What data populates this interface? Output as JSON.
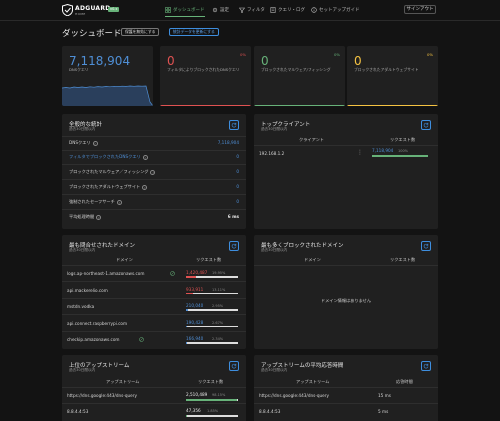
{
  "header": {
    "logo_text": "ADGUARD",
    "logo_sub": "HOME",
    "badge": "v0.x",
    "nav": [
      {
        "label": "ダッシュボード",
        "icon": "dashboard-icon",
        "active": true
      },
      {
        "label": "設定",
        "icon": "gear-icon",
        "active": false
      },
      {
        "label": "フィルタ",
        "icon": "filter-icon",
        "active": false
      },
      {
        "label": "クエリ・ログ",
        "icon": "log-icon",
        "active": false
      },
      {
        "label": "セットアップガイド",
        "icon": "guide-icon",
        "active": false
      }
    ],
    "signout_label": "サインアウト"
  },
  "title_row": {
    "title": "ダッシュボード",
    "protection_button": "保護を無効にする",
    "refresh_button": "統計データを更新にする"
  },
  "stats": [
    {
      "value": "7,118,904",
      "label": "DNSクエリ",
      "pct": "",
      "color": "#4f8fd6"
    },
    {
      "value": "0",
      "label": "フィルタによりブロックされたDNSクエリ",
      "pct": "0%",
      "color": "#e05252"
    },
    {
      "value": "0",
      "label": "ブロックされたマルウェア/フィッシング",
      "pct": "0%",
      "color": "#67b279"
    },
    {
      "value": "0",
      "label": "ブロックされたアダルトウェブサイト",
      "pct": "0%",
      "color": "#f5c342"
    }
  ],
  "general_stats": {
    "title": "全般的な統計",
    "subtitle": "過去30日間以内",
    "rows": [
      {
        "label": "DNSクエリ",
        "value": "7,118,904",
        "label_blue": false
      },
      {
        "label": "フィルタでブロックされたDNSクエリ",
        "value": "0",
        "label_blue": true
      },
      {
        "label": "ブロックされたマルウェア／フィッシング",
        "value": "0",
        "label_blue": false
      },
      {
        "label": "ブロックされたアダルトウェブサイト",
        "value": "0",
        "label_blue": false
      },
      {
        "label": "強制されたセーフサーチ",
        "value": "0",
        "label_blue": false
      },
      {
        "label": "平均処理時間",
        "value": "6 ms",
        "label_blue": false
      }
    ]
  },
  "top_clients": {
    "title": "トップクライアント",
    "subtitle": "過去30日間以内",
    "col_client": "クライアント",
    "col_requests": "リクエスト数",
    "rows": [
      {
        "client": "192.168.1.2",
        "count": "7,118,904",
        "pct": "100%",
        "fraction": 1.0
      }
    ]
  },
  "top_domains": {
    "title": "最も問合せされたドメイン",
    "subtitle": "過去30日間以内",
    "col_domain": "ドメイン",
    "col_requests": "リクエスト数",
    "rows": [
      {
        "domain": "logs.ap-northeast-1.amazonaws.com",
        "count": "1,420,487",
        "pct": "19.95%",
        "fraction": 0.1995,
        "color": "#e05252",
        "blocked_icon": true
      },
      {
        "domain": "api.mackerelio.com",
        "count": "933,911",
        "pct": "13.11%",
        "fraction": 0.1311,
        "color": "#e05252",
        "blocked_icon": false
      },
      {
        "domain": "mstdn.vodka",
        "count": "210,040",
        "pct": "2.95%",
        "fraction": 0.0295,
        "color": "#4f8fd6",
        "blocked_icon": false
      },
      {
        "domain": "api.connect.raspberrypi.com",
        "count": "190,428",
        "pct": "2.67%",
        "fraction": 0.0267,
        "color": "#4f8fd6",
        "blocked_icon": false
      },
      {
        "domain": "checkip.amazonaws.com",
        "count": "166,940",
        "pct": "2.34%",
        "fraction": 0.0234,
        "color": "#4f8fd6",
        "blocked_icon": true
      }
    ]
  },
  "blocked_domains": {
    "title": "最も多くブロックされたドメイン",
    "subtitle": "過去30日間以内",
    "col_domain": "ドメイン",
    "col_requests": "リクエスト数",
    "empty_text": "ドメイン情報はありません"
  },
  "top_upstreams": {
    "title": "上位のアップストリーム",
    "subtitle": "過去30日間以内",
    "col_upstream": "アップストリーム",
    "col_requests": "リクエスト数",
    "rows": [
      {
        "upstream": "https://dns.google:443/dns-query",
        "count": "2,510,489",
        "pct": "98.15%",
        "fraction": 0.9815
      },
      {
        "upstream": "8.8.4.4:53",
        "count": "47,356",
        "pct": "1.85%",
        "fraction": 0.0185
      }
    ]
  },
  "upstream_avg": {
    "title": "アップストリームの平均応答時間",
    "subtitle": "過去30日間以内",
    "col_upstream": "アップストリーム",
    "col_time": "応答時間",
    "rows": [
      {
        "upstream": "https://dns.google:443/dns-query",
        "time": "15 ms"
      },
      {
        "upstream": "8.8.4.4:53",
        "time": "5 ms"
      }
    ]
  }
}
